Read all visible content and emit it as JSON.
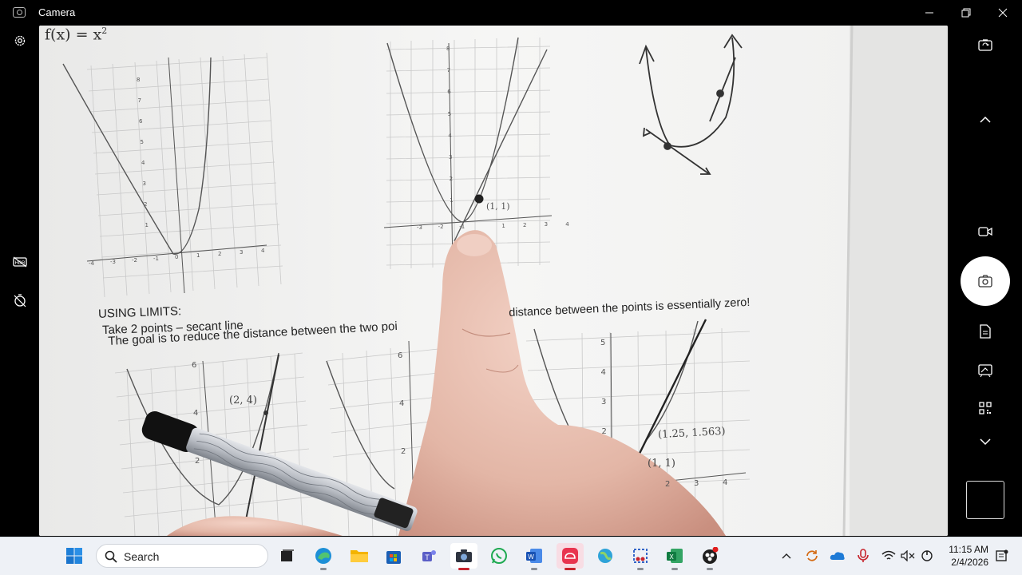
{
  "window": {
    "title": "Camera",
    "minimize_icon": "minimize-icon",
    "maximize_icon": "restore-icon",
    "close_icon": "close-icon"
  },
  "left_rail": [
    {
      "name": "settings-icon"
    },
    {
      "name": "hdr-off-icon"
    },
    {
      "name": "timer-off-icon"
    }
  ],
  "right_rail": [
    {
      "name": "switch-camera-icon"
    },
    {
      "name": "chevron-up-icon"
    },
    {
      "name": "video-mode-icon"
    },
    {
      "name": "photo-mode-icon"
    },
    {
      "name": "document-mode-icon"
    },
    {
      "name": "whiteboard-mode-icon"
    },
    {
      "name": "qr-code-mode-icon"
    },
    {
      "name": "chevron-down-icon"
    }
  ],
  "worksheet": {
    "function_label": "f(x) = x",
    "function_exp": "2",
    "heading": "USING LIMITS:",
    "line1": "Take 2 points – secant line",
    "line2_a": "The goal is to reduce the distance between the two poi",
    "line2_b": "distance between the points is essentially zero!",
    "point_top": "(1, 1)",
    "point_b1": "(2, 4)",
    "point_b3a": "(1.25, 1.563)",
    "point_b3b": "(1, 1)",
    "yticks1": [
      "1",
      "2",
      "3",
      "4",
      "5",
      "6",
      "7",
      "8"
    ],
    "xticks1": [
      "-4",
      "-3",
      "-2",
      "-1",
      "0",
      "1",
      "2",
      "3",
      "4"
    ],
    "yticks2": [
      "1",
      "2",
      "3",
      "4",
      "5",
      "6",
      "7",
      "8"
    ],
    "xticks2": [
      "-3",
      "-2",
      "-1",
      "",
      "1",
      "2",
      "3",
      "4"
    ],
    "yticks_b1": [
      "2",
      "4",
      "6"
    ],
    "yticks_b2": [
      "2",
      "4",
      "6"
    ],
    "yticks_b3": [
      "2",
      "3",
      "4",
      "5"
    ],
    "xticks_b3": [
      "2",
      "3",
      "4"
    ]
  },
  "taskbar": {
    "search_placeholder": "Search",
    "apps": [
      {
        "name": "start-button"
      },
      {
        "name": "task-view-icon"
      },
      {
        "name": "edge-icon"
      },
      {
        "name": "file-explorer-icon"
      },
      {
        "name": "microsoft-store-icon"
      },
      {
        "name": "teams-icon"
      },
      {
        "name": "camera-app-icon",
        "active": true
      },
      {
        "name": "whatsapp-icon"
      },
      {
        "name": "word-icon"
      },
      {
        "name": "creative-cloud-icon"
      },
      {
        "name": "maps-icon"
      },
      {
        "name": "snipping-tool-icon"
      },
      {
        "name": "excel-icon"
      },
      {
        "name": "obs-icon"
      }
    ],
    "time": "11:15 AM",
    "date": "2/4/2026"
  },
  "colors": {
    "background": "#000000",
    "paper": "#f2f2f2",
    "taskbar": "#eef1f6",
    "accent_red": "#c7242d"
  }
}
